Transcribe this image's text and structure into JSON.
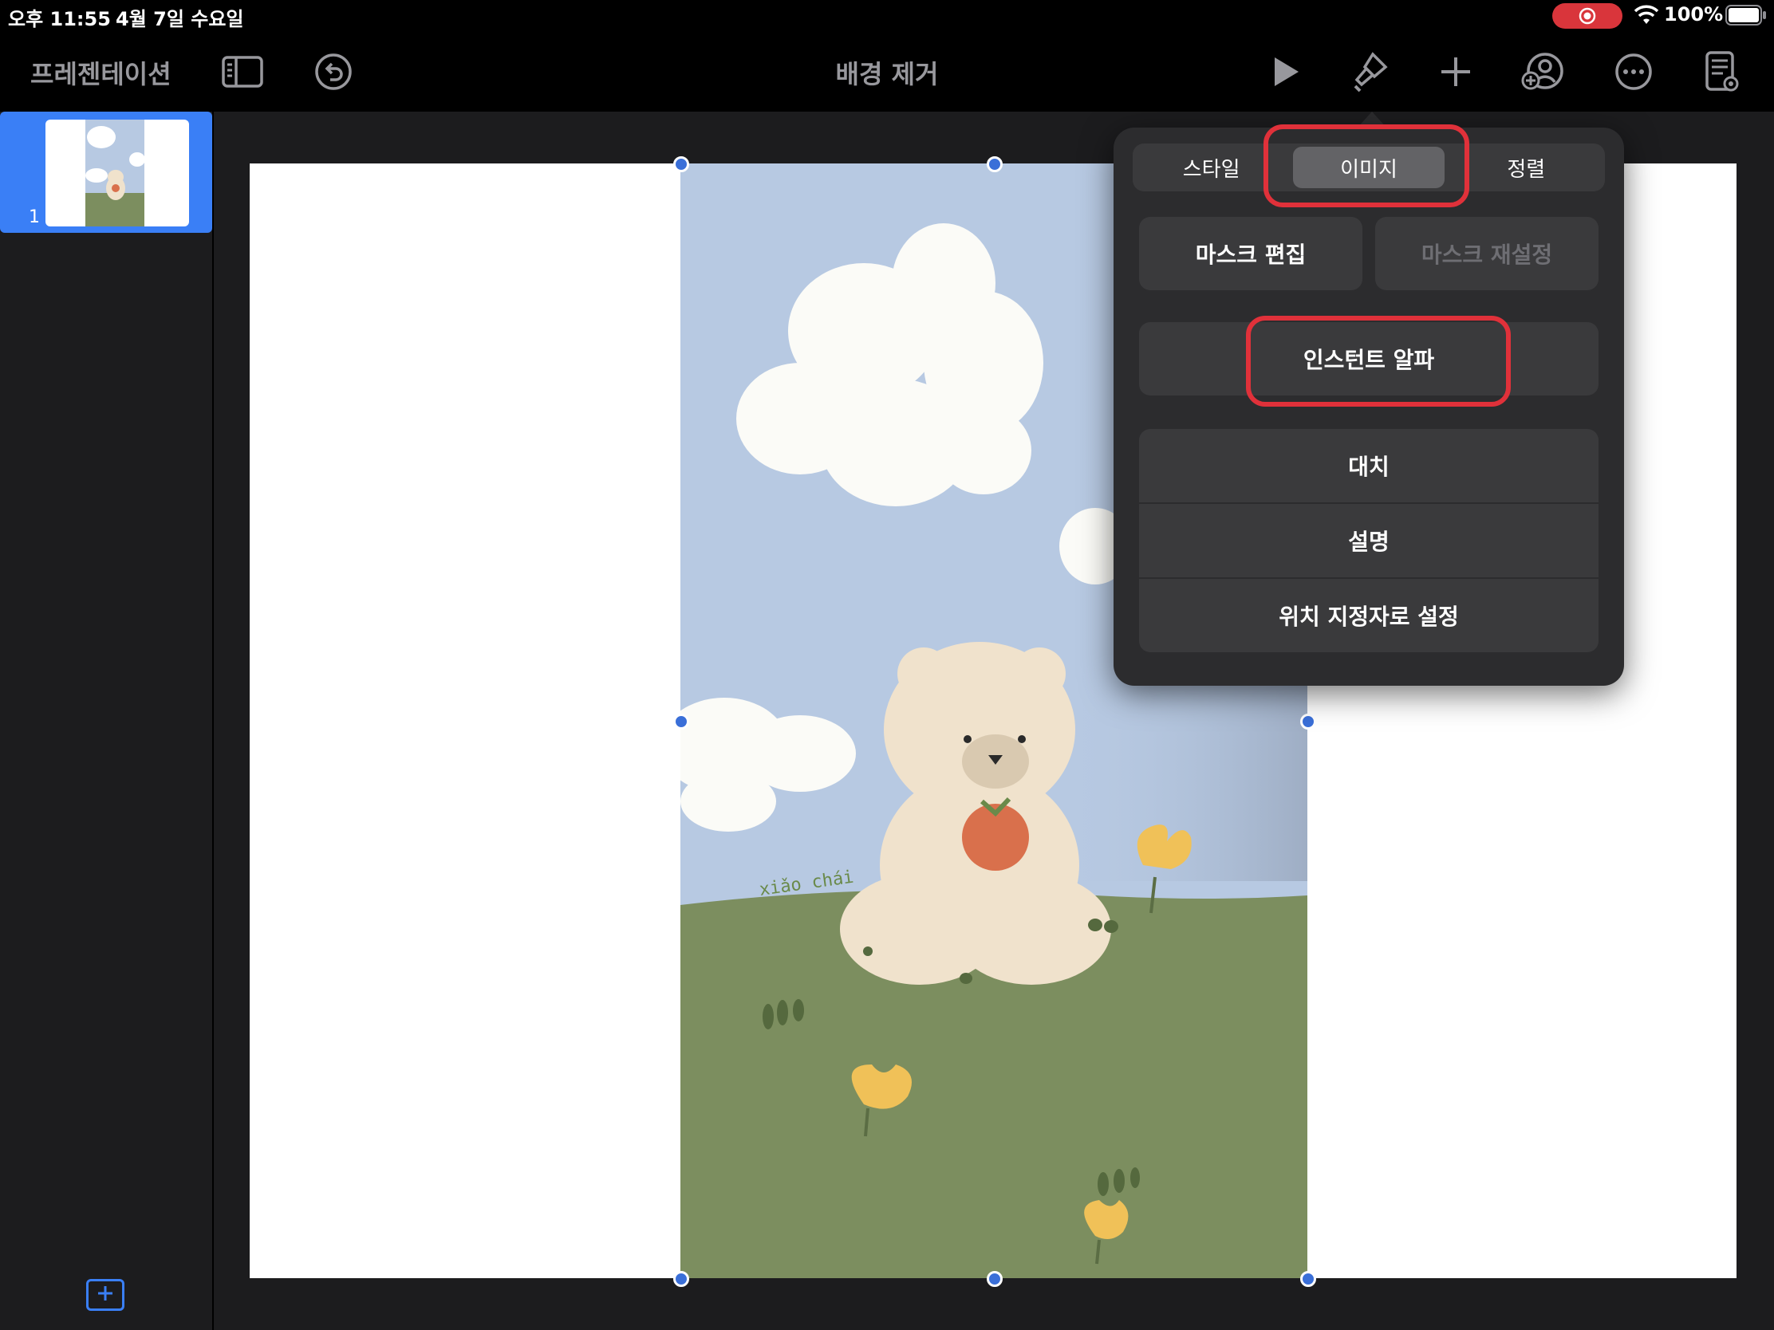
{
  "status_bar": {
    "time": "오후 11:55",
    "date": "4월 7일 수요일",
    "battery": "100%"
  },
  "toolbar": {
    "app_label": "프레젠테이션",
    "document_title": "배경 제거"
  },
  "navigator": {
    "slides": [
      {
        "number": "1"
      }
    ]
  },
  "canvas": {
    "artwork_signature": "xiǎo chái"
  },
  "popover": {
    "tabs": [
      {
        "label": "스타일",
        "active": false
      },
      {
        "label": "이미지",
        "active": true
      },
      {
        "label": "정렬",
        "active": false
      }
    ],
    "edit_mask": "마스크 편집",
    "reset_mask": "마스크 재설정",
    "instant_alpha": "인스턴트 알파",
    "replace": "대치",
    "description": "설명",
    "set_as_placeholder": "위치 지정자로 설정"
  },
  "colors": {
    "accent": "#3a7ff6",
    "annotation": "#e0313a",
    "recording": "#d9353b",
    "sky": "#b7c9e2",
    "grass": "#7c8e5f"
  },
  "icons": [
    "sidebar-icon",
    "undo-icon",
    "play-icon",
    "paintbrush-icon",
    "plus-icon",
    "collaborate-icon",
    "more-icon",
    "presenter-notes-icon",
    "wifi-icon",
    "battery-icon",
    "record-icon",
    "add-slide-icon"
  ]
}
